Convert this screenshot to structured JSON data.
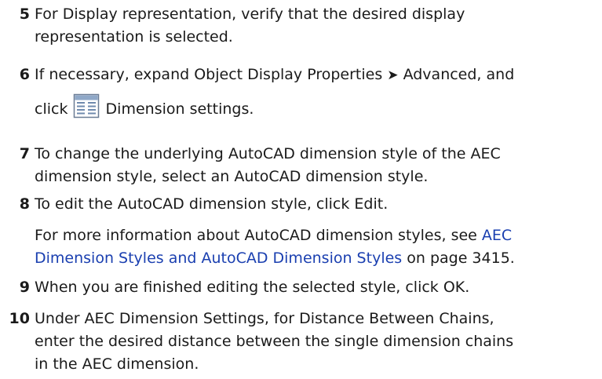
{
  "steps": [
    {
      "number": "5",
      "line1": "For Display representation, verify that the desired display",
      "line2": "representation is selected."
    },
    {
      "number": "6",
      "line1_pre": "If necessary, expand Object Display Properties",
      "arrow": "➤",
      "line1_post": "Advanced, and",
      "line2_pre": "click",
      "icon": "dimension-settings-icon",
      "line2_post": "Dimension settings."
    },
    {
      "number": "7",
      "line1": "To change the underlying AutoCAD dimension style of the AEC",
      "line2": "dimension style, select an AutoCAD dimension style."
    },
    {
      "number": "8",
      "line1": "To edit the AutoCAD dimension style, click Edit."
    },
    {
      "number": "9",
      "line1": "When you are finished editing the selected style, click OK."
    },
    {
      "number": "10",
      "line1": "Under AEC Dimension Settings, for Distance Between Chains,",
      "line2": "enter the desired distance between the single dimension chains",
      "line3": "in the AEC dimension."
    }
  ],
  "note": {
    "line1_pre": "For more information about AutoCAD dimension styles, see",
    "link_part1": "AEC",
    "link_part2": "Dimension Styles and AutoCAD Dimension Styles",
    "line2_post": "on page 3415."
  },
  "colors": {
    "text": "#1a1a1a",
    "link": "#1a3fb0"
  }
}
